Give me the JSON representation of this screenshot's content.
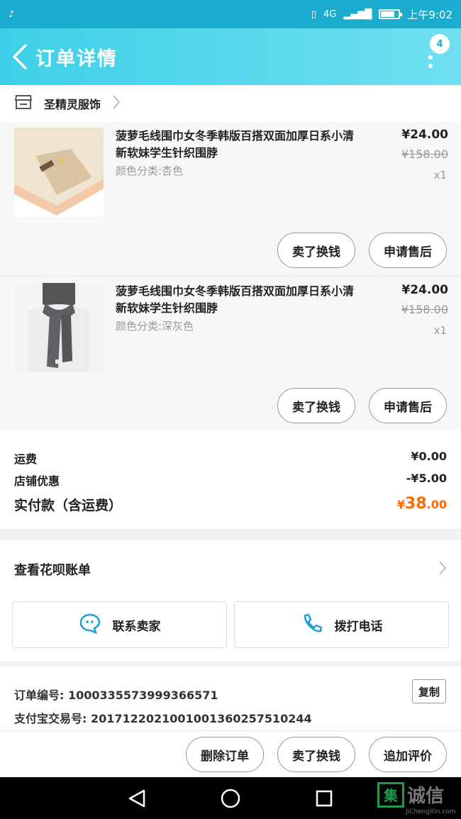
{
  "status_bar": {
    "time": "上午9:02",
    "network": "4G",
    "left_icon": "tiktok-icon"
  },
  "header": {
    "title": "订单详情",
    "badge_count": "4"
  },
  "shop": {
    "name": "圣精灵服饰"
  },
  "products": [
    {
      "title": "菠萝毛线围巾女冬季韩版百搭双面加厚日系小清新软妹学生针织围脖",
      "sku": "颜色分类:杏色",
      "price": "¥24.00",
      "original_price": "¥158.00",
      "quantity": "x1",
      "btn_exchange": "卖了换钱",
      "btn_aftersale": "申请售后"
    },
    {
      "title": "菠萝毛线围巾女冬季韩版百搭双面加厚日系小清新软妹学生针织围脖",
      "sku": "颜色分类:深灰色",
      "price": "¥24.00",
      "original_price": "¥158.00",
      "quantity": "x1",
      "btn_exchange": "卖了换钱",
      "btn_aftersale": "申请售后"
    }
  ],
  "summary": {
    "shipping_label": "运费",
    "shipping_value": "¥0.00",
    "discount_label": "店铺优惠",
    "discount_value": "-¥5.00",
    "paid_label": "实付款（含运费）",
    "paid_currency": "¥",
    "paid_int": "38",
    "paid_dec": ".00"
  },
  "huabei": {
    "label": "查看花呗账单",
    "contact_seller": "联系卖家",
    "call_phone": "拨打电话"
  },
  "order_info": {
    "order_no": "订单编号: 1000335573999366571",
    "alipay_no": "支付宝交易号: 2017122021001001360257510244",
    "copy_label": "复制"
  },
  "actions": {
    "delete": "删除订单",
    "sell": "卖了换钱",
    "review": "追加评价"
  },
  "watermark": {
    "char": "集",
    "text": "诚信",
    "sub": "JiChengXin.com"
  },
  "colors": {
    "header": "#3ed0e8",
    "accent_orange": "#ff6a00",
    "primary_blue": "#1aaccf"
  }
}
